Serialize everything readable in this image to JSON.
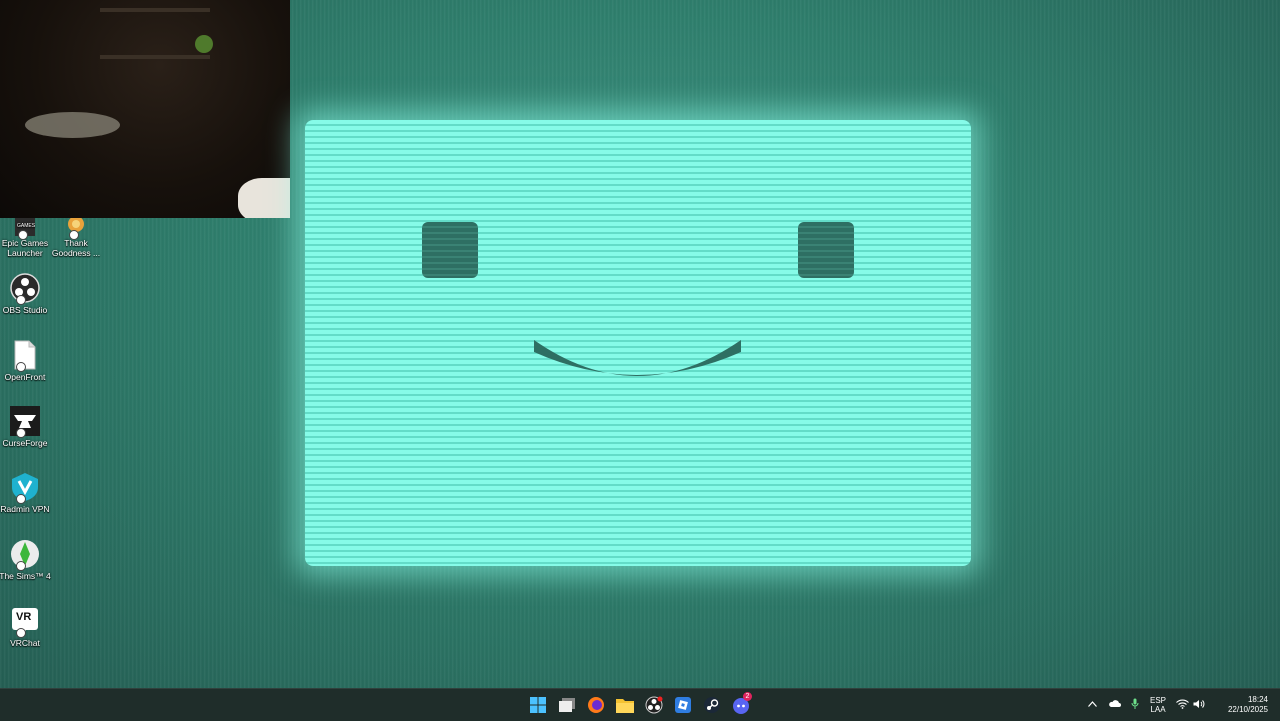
{
  "desktop_icons": [
    {
      "label": "Epic Games Launcher",
      "icon": "epic-games-icon",
      "badge": "GAMES"
    },
    {
      "label": "Thank Goodness ...",
      "icon": "thank-goodness-icon"
    },
    {
      "label": "OBS Studio",
      "icon": "obs-icon"
    },
    {
      "label": "OpenFront",
      "icon": "file-icon"
    },
    {
      "label": "CurseForge",
      "icon": "curseforge-icon"
    },
    {
      "label": "Radmin VPN",
      "icon": "radmin-vpn-icon"
    },
    {
      "label": "The Sims™ 4",
      "icon": "sims4-icon"
    },
    {
      "label": "VRChat",
      "icon": "vrchat-icon",
      "badge": "VR"
    }
  ],
  "taskbar": {
    "apps": [
      {
        "name": "start",
        "icon": "windows-start-icon"
      },
      {
        "name": "task-view",
        "icon": "task-view-icon"
      },
      {
        "name": "firefox",
        "icon": "firefox-icon"
      },
      {
        "name": "file-explorer",
        "icon": "folder-icon"
      },
      {
        "name": "obs",
        "icon": "obs-icon"
      },
      {
        "name": "roblox-studio",
        "icon": "roblox-icon"
      },
      {
        "name": "steam",
        "icon": "steam-icon"
      },
      {
        "name": "discord",
        "icon": "discord-icon",
        "badge": "2"
      }
    ],
    "tray": {
      "lang_top": "ESP",
      "lang_bottom": "LAA",
      "time": "18:24",
      "date": "22/10/2025"
    }
  },
  "colors": {
    "accent_screen": "#86fbe8",
    "face": "#2e6f63",
    "taskbar": "#1f2d2a"
  }
}
